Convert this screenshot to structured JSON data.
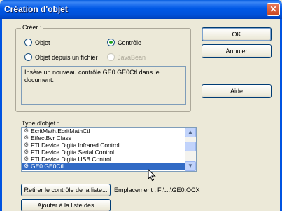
{
  "dialog": {
    "title": "Création d'objet",
    "close_glyph": "✕"
  },
  "create_group": {
    "label": "Créer :",
    "options": [
      {
        "label": "Objet",
        "checked": false,
        "disabled": false
      },
      {
        "label": "Contrôle",
        "checked": true,
        "disabled": false
      },
      {
        "label": "Objet depuis un fichier",
        "checked": false,
        "disabled": false
      },
      {
        "label": "JavaBean",
        "checked": false,
        "disabled": true
      }
    ],
    "description": "Insère un nouveau contrôle GE0.GE0Ctl dans le document."
  },
  "buttons": {
    "ok": "OK",
    "cancel": "Annuler",
    "help": "Aide",
    "remove": "Retirer le contrôle de la liste...",
    "add": "Ajouter à la liste des contrôles..."
  },
  "type_list": {
    "label": "Type d'objet :",
    "items": [
      {
        "label": "EcritMath.EcritMathCtl",
        "selected": false
      },
      {
        "label": "EffectBvr Class",
        "selected": false
      },
      {
        "label": "FTI Device Digita Infrared Control",
        "selected": false
      },
      {
        "label": "FTI Device Digita Serial Control",
        "selected": false
      },
      {
        "label": "FTI Device Digita USB Control",
        "selected": false
      },
      {
        "label": "GE0.GE0Ctl",
        "selected": true
      }
    ]
  },
  "location": {
    "label": "Emplacement :",
    "value": "F:\\...\\GE0.OCX"
  },
  "colors": {
    "title_bar": "#0054e3",
    "selection": "#316ac5",
    "radio_on": "#21a121"
  }
}
